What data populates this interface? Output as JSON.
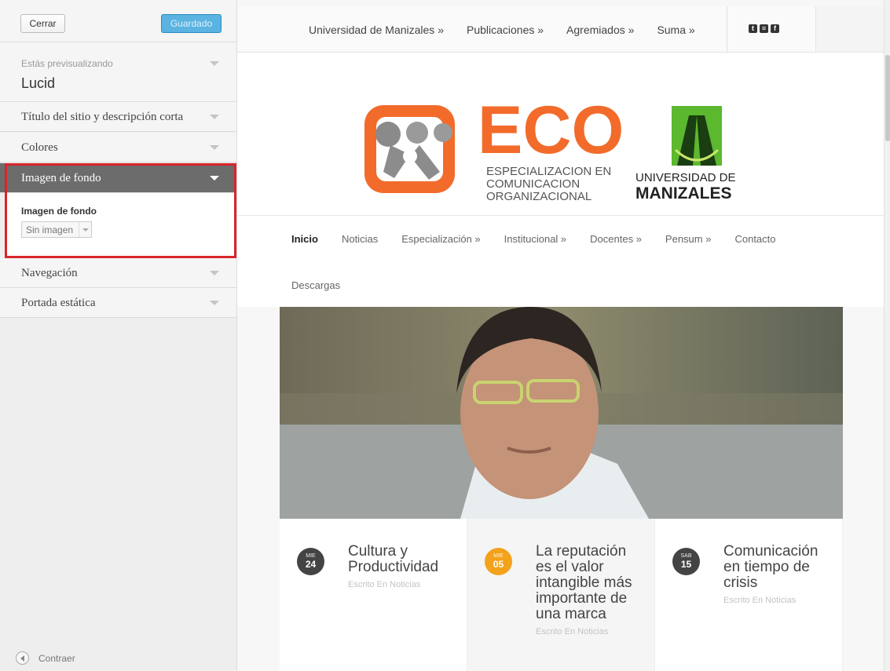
{
  "sidebar": {
    "close_label": "Cerrar",
    "saved_label": "Guardado",
    "previewing_label": "Estás previsualizando",
    "theme_name": "Lucid",
    "sections": [
      {
        "label": "Título del sitio y descripción corta"
      },
      {
        "label": "Colores"
      },
      {
        "label": "Imagen de fondo"
      },
      {
        "label": "Navegación"
      },
      {
        "label": "Portada estática"
      }
    ],
    "background_panel": {
      "field_label": "Imagen de fondo",
      "select_value": "Sin imagen"
    },
    "collapse_label": "Contraer"
  },
  "site": {
    "top_nav": [
      "Universidad de Manizales »",
      "Publicaciones »",
      "Agremiados »",
      "Suma »"
    ],
    "social_icons": [
      "twitter-icon",
      "rss-icon",
      "facebook-icon"
    ],
    "logo": {
      "eco": "ECO",
      "line1": "ESPECIALIZACION EN",
      "line2": "COMUNICACION",
      "line3": "ORGANIZACIONAL",
      "university_line1": "UNIVERSIDAD DE",
      "university_line2": "MANIZALES",
      "colors": {
        "eco_orange": "#f26b2b",
        "university_green": "#5cb82e"
      }
    },
    "main_nav": [
      "Inicio",
      "Noticias",
      "Especialización »",
      "Institucional »",
      "Docentes »",
      "Pensum »",
      "Contacto"
    ],
    "main_nav_row2": "Descargas",
    "posts": [
      {
        "day": "MIE",
        "num": "24",
        "title": "Cultura y Productividad",
        "meta": "Escrito En Noticias"
      },
      {
        "day": "MIE",
        "num": "05",
        "title": "La reputación es el valor intangible más importante de una marca",
        "meta": "Escrito En Noticias"
      },
      {
        "day": "SAB",
        "num": "15",
        "title": "Comunicación en tiempo de crisis",
        "meta": "Escrito En Noticias"
      }
    ]
  },
  "colors": {
    "accent_blue": "#5ab3e0",
    "highlight_red": "#d8252a",
    "date_orange": "#f3a21b"
  }
}
